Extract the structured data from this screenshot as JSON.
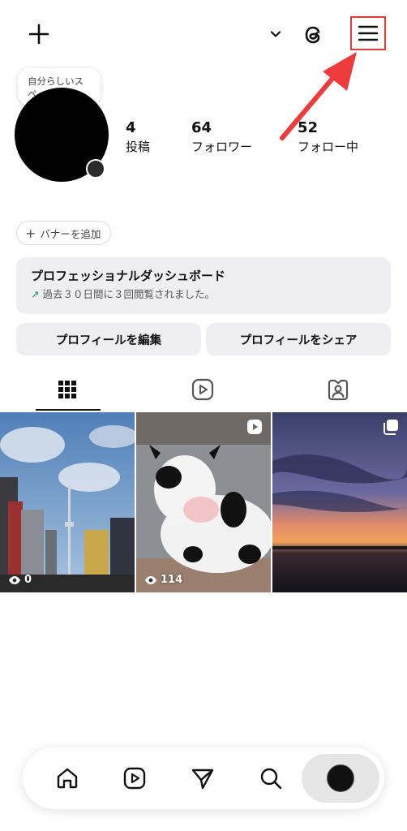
{
  "header": {
    "icons": [
      "plus-icon",
      "chevron-down-icon",
      "threads-icon",
      "menu-icon"
    ],
    "accent": "#e03a3a"
  },
  "profile": {
    "note": "自分らしいス\nペ",
    "stats": [
      {
        "value": "4",
        "label": "投稿"
      },
      {
        "value": "64",
        "label": "フォロワー"
      },
      {
        "value": "52",
        "label": "フォロー中"
      }
    ]
  },
  "banner": {
    "label": "バナーを追加"
  },
  "dashboard": {
    "title": "プロフェッショナルダッシュボード",
    "subtitle": "過去３０日間に３回閲覧されました。"
  },
  "actions": {
    "edit": "プロフィールを編集",
    "share": "プロフィールをシェア"
  },
  "tabs": [
    "grid-icon",
    "reels-icon",
    "tagged-icon"
  ],
  "posts": [
    {
      "views": "0"
    },
    {
      "views": "114"
    },
    {
      "views": ""
    }
  ],
  "bottom_nav": [
    "home-icon",
    "reels-icon",
    "send-icon",
    "search-icon",
    "profile-avatar"
  ]
}
